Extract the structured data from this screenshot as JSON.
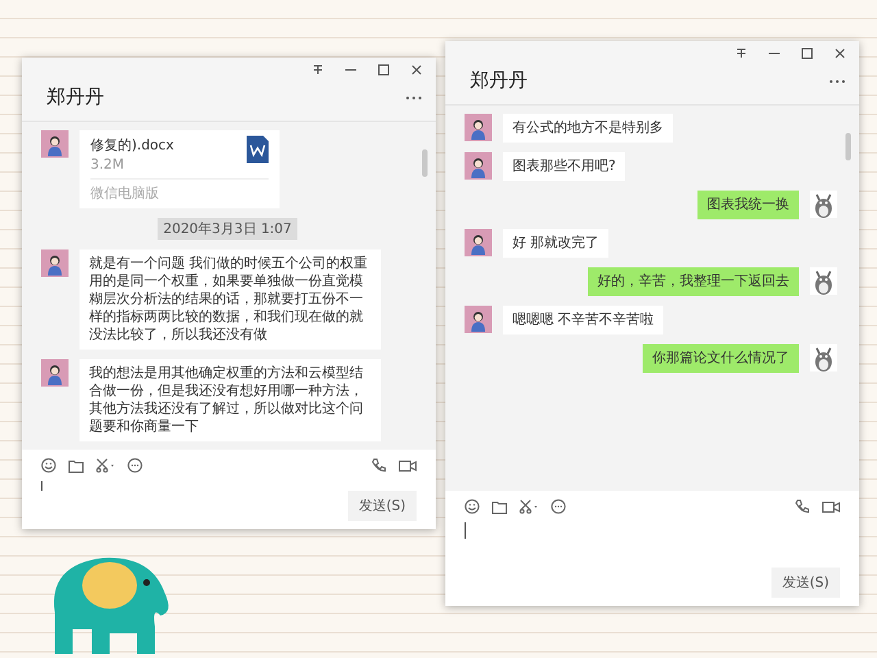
{
  "windows": [
    {
      "title": "郑丹丹",
      "messages": [
        {
          "kind": "file",
          "file_name": "修复的).docx",
          "size": "3.2M",
          "source": "微信电脑版"
        },
        {
          "kind": "time",
          "text": "2020年3月3日 1:07"
        },
        {
          "kind": "received",
          "text": "就是有一个问题 我们做的时候五个公司的权重用的是同一个权重，如果要单独做一份直觉模糊层次分析法的结果的话，那就要打五份不一样的指标两两比较的数据，和我们现在做的就没法比较了，所以我还没有做"
        },
        {
          "kind": "received",
          "text": "我的想法是用其他确定权重的方法和云模型结合做一份，但是我还没有想好用哪一种方法，其他方法我还没有了解过，所以做对比这个问题要和你商量一下"
        }
      ],
      "send_button": "发送(S)"
    },
    {
      "title": "郑丹丹",
      "messages": [
        {
          "kind": "received",
          "text": "有公式的地方不是特别多"
        },
        {
          "kind": "received",
          "text": "图表那些不用吧?"
        },
        {
          "kind": "sent",
          "text": "图表我统一换"
        },
        {
          "kind": "received",
          "text": "好 那就改完了"
        },
        {
          "kind": "sent",
          "text": "好的，辛苦，我整理一下返回去"
        },
        {
          "kind": "received",
          "text": "嗯嗯嗯  不辛苦不辛苦啦"
        },
        {
          "kind": "sent",
          "text": "你那篇论文什么情况了"
        }
      ],
      "send_button": "发送(S)"
    }
  ]
}
